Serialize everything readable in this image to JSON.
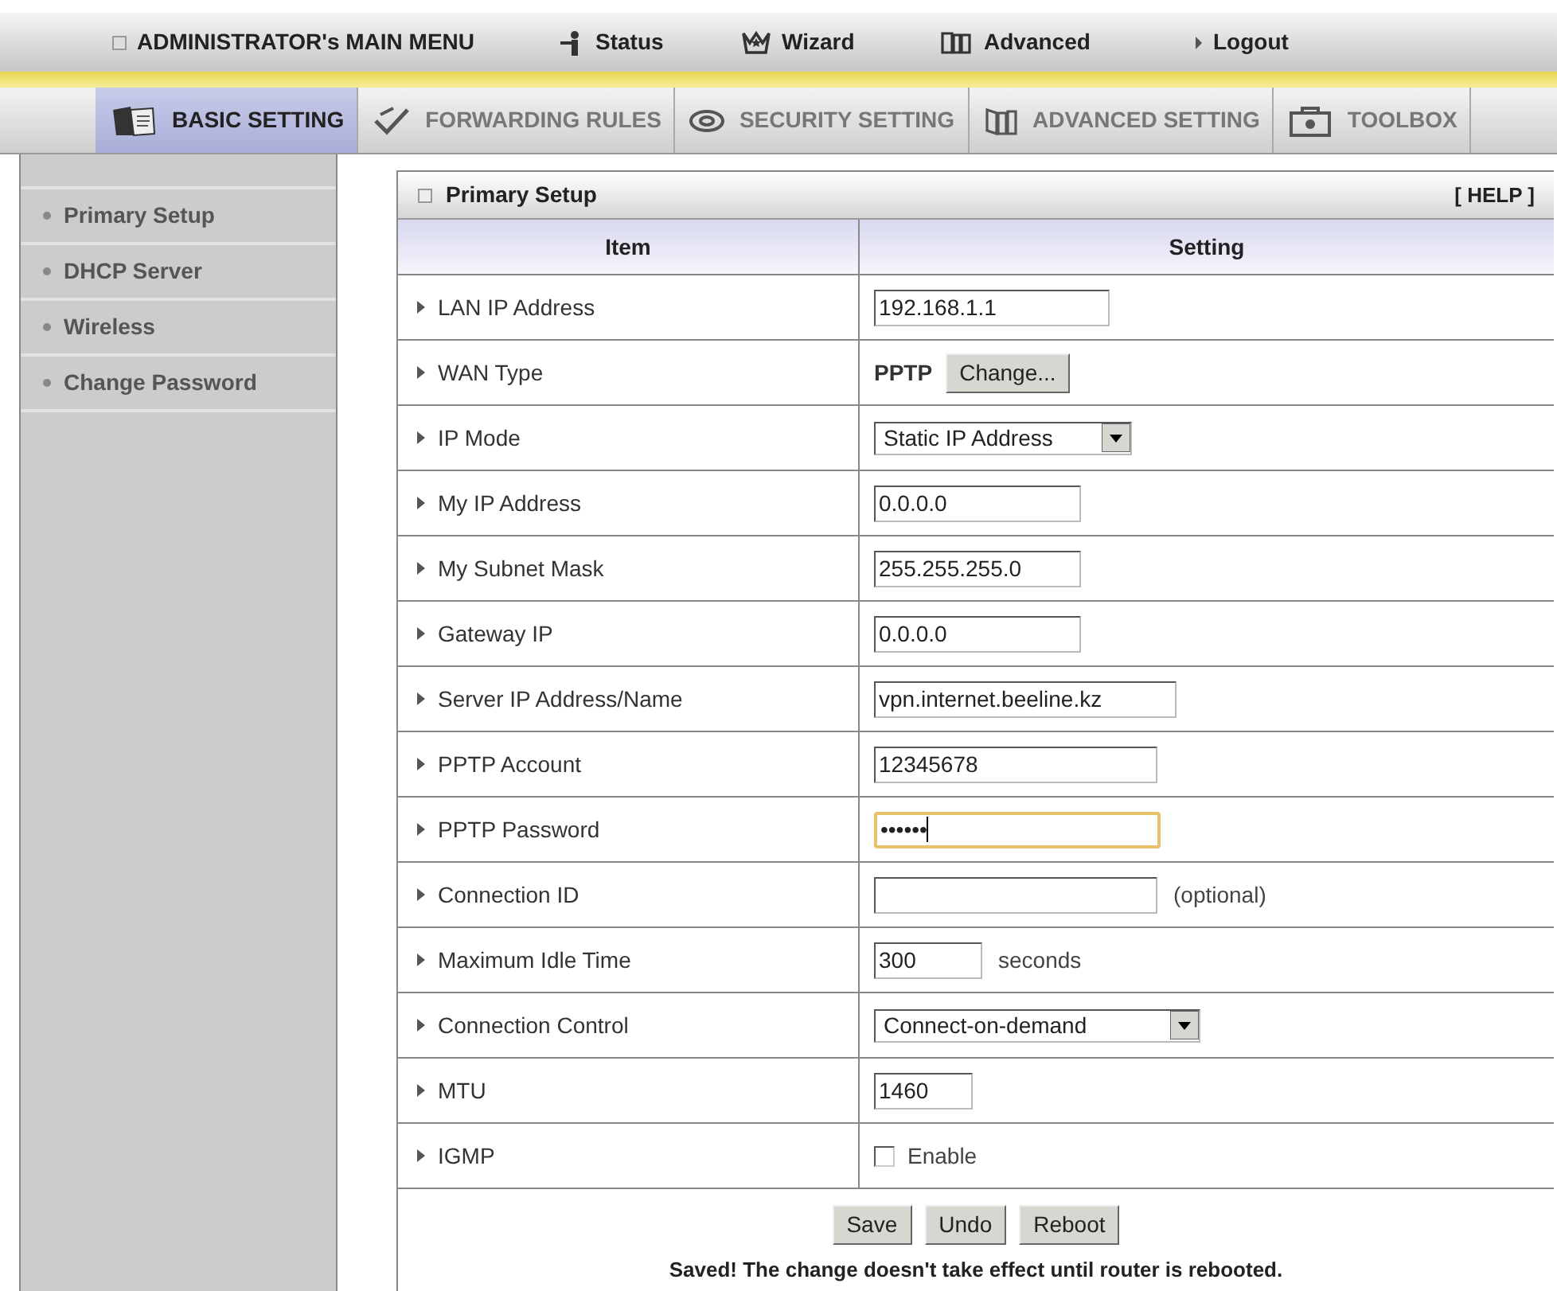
{
  "top_menu": [
    {
      "label": "ADMINISTRATOR's MAIN MENU"
    },
    {
      "label": "Status"
    },
    {
      "label": "Wizard"
    },
    {
      "label": "Advanced"
    },
    {
      "label": "Logout"
    }
  ],
  "tabs": [
    {
      "label": "BASIC SETTING",
      "selected": true
    },
    {
      "label": "FORWARDING RULES",
      "selected": false
    },
    {
      "label": "SECURITY SETTING",
      "selected": false
    },
    {
      "label": "ADVANCED SETTING",
      "selected": false
    },
    {
      "label": "TOOLBOX",
      "selected": false
    }
  ],
  "sidebar": {
    "items": [
      {
        "label": "Primary Setup"
      },
      {
        "label": "DHCP Server"
      },
      {
        "label": "Wireless"
      },
      {
        "label": "Change Password"
      }
    ]
  },
  "panel": {
    "title": "Primary Setup",
    "help": "[ HELP ]",
    "columns": [
      "Item",
      "Setting"
    ],
    "rows": [
      {
        "item": "LAN IP Address",
        "kind": "input",
        "value": "192.168.1.1",
        "focused": false
      },
      {
        "item": "WAN Type",
        "kind": "type_button",
        "value": "PPTP",
        "button": "Change..."
      },
      {
        "item": "IP Mode",
        "kind": "select",
        "value": "Static IP Address"
      },
      {
        "item": "My IP Address",
        "kind": "input",
        "value": "0.0.0.0",
        "focused": false
      },
      {
        "item": "My Subnet Mask",
        "kind": "input",
        "value": "255.255.255.0",
        "focused": false
      },
      {
        "item": "Gateway IP",
        "kind": "input",
        "value": "0.0.0.0",
        "focused": false
      },
      {
        "item": "Server IP Address/Name",
        "kind": "input",
        "value": "vpn.internet.beeline.kz",
        "focused": false
      },
      {
        "item": "PPTP Account",
        "kind": "input",
        "value": "12345678",
        "focused": false
      },
      {
        "item": "PPTP Password",
        "kind": "input",
        "value": "••••••",
        "focused": true
      },
      {
        "item": "Connection ID",
        "kind": "input",
        "value": "",
        "suffix": "(optional)",
        "focused": false
      },
      {
        "item": "Maximum Idle Time",
        "kind": "input",
        "value": "300",
        "suffix": "seconds",
        "focused": false
      },
      {
        "item": "Connection Control",
        "kind": "select",
        "value": "Connect-on-demand"
      },
      {
        "item": "MTU",
        "kind": "input",
        "value": "1460",
        "focused": false
      },
      {
        "item": "IGMP",
        "kind": "checkbox",
        "label": "Enable",
        "checked": false
      }
    ],
    "buttons": [
      "Save",
      "Undo",
      "Reboot"
    ],
    "message": "Saved! The change doesn't take effect until router is rebooted."
  }
}
